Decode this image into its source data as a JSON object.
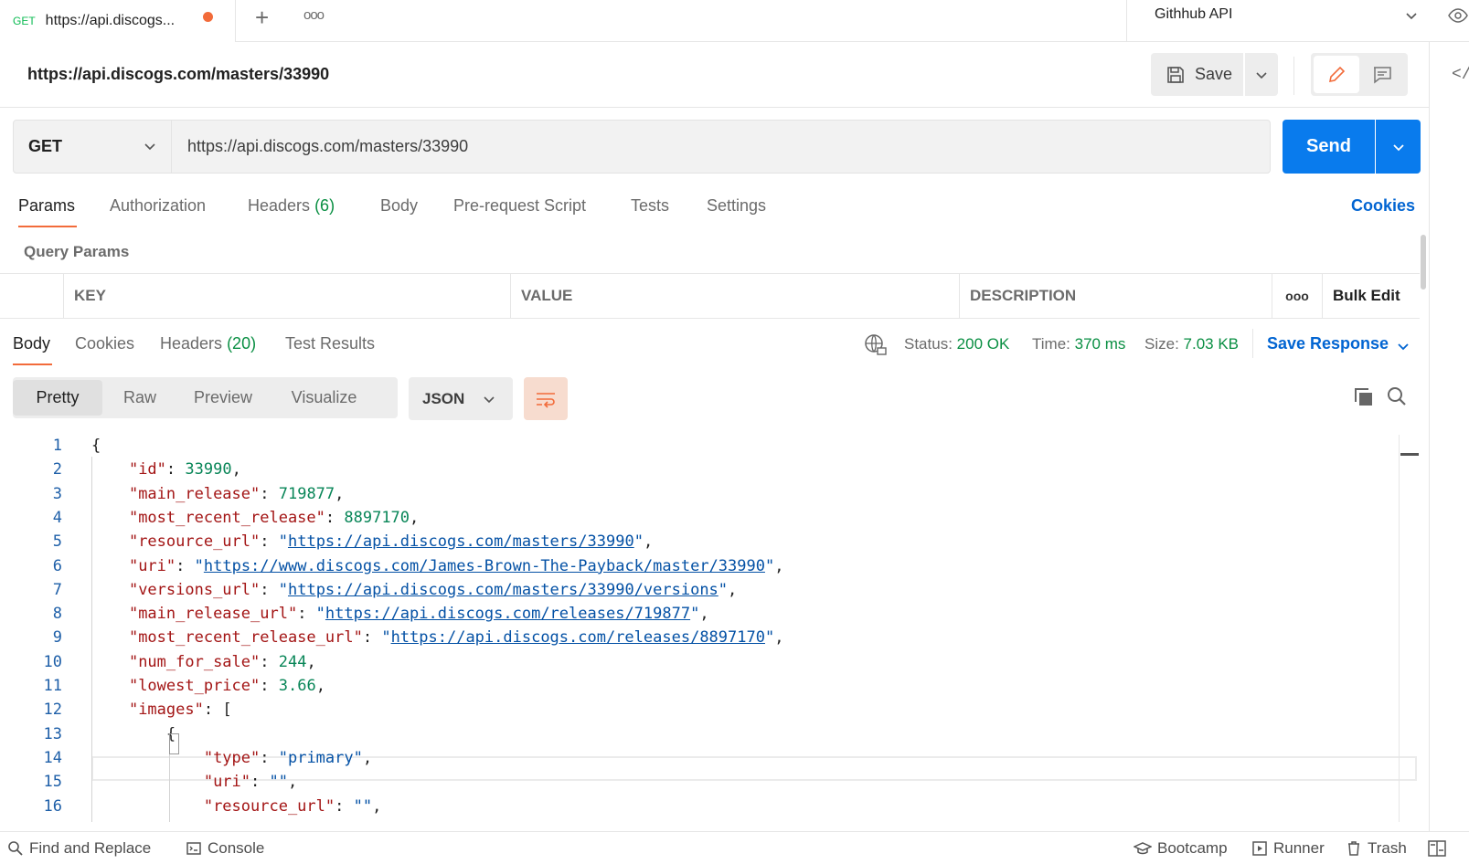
{
  "tabs": {
    "active": {
      "method": "GET",
      "title": "https://api.discogs..."
    },
    "environment": "Githhub API"
  },
  "request": {
    "title": "https://api.discogs.com/masters/33990",
    "save_label": "Save",
    "method": "GET",
    "url": "https://api.discogs.com/masters/33990",
    "send_label": "Send"
  },
  "request_tabs": {
    "params": "Params",
    "authorization": "Authorization",
    "headers": "Headers",
    "headers_count": "(6)",
    "body": "Body",
    "prerequest": "Pre-request Script",
    "tests": "Tests",
    "settings": "Settings",
    "cookies": "Cookies"
  },
  "query_params": {
    "label": "Query Params",
    "columns": {
      "key": "KEY",
      "value": "VALUE",
      "description": "DESCRIPTION",
      "more": "ooo",
      "bulk_edit": "Bulk Edit"
    }
  },
  "response_tabs": {
    "body": "Body",
    "cookies": "Cookies",
    "headers": "Headers",
    "headers_count": "(20)",
    "test_results": "Test Results"
  },
  "response_status": {
    "status_label": "Status:",
    "status_value": "200 OK",
    "time_label": "Time:",
    "time_value": "370 ms",
    "size_label": "Size:",
    "size_value": "7.03 KB",
    "save_response": "Save Response"
  },
  "view_modes": {
    "pretty": "Pretty",
    "raw": "Raw",
    "preview": "Preview",
    "visualize": "Visualize",
    "format": "JSON"
  },
  "code_lines": [
    {
      "n": "1",
      "parts": [
        [
          "p",
          "{"
        ]
      ]
    },
    {
      "n": "2",
      "parts": [
        [
          "p",
          "    "
        ],
        [
          "k",
          "\"id\""
        ],
        [
          "p",
          ": "
        ],
        [
          "n",
          "33990"
        ],
        [
          "p",
          ","
        ]
      ]
    },
    {
      "n": "3",
      "parts": [
        [
          "p",
          "    "
        ],
        [
          "k",
          "\"main_release\""
        ],
        [
          "p",
          ": "
        ],
        [
          "n",
          "719877"
        ],
        [
          "p",
          ","
        ]
      ]
    },
    {
      "n": "4",
      "parts": [
        [
          "p",
          "    "
        ],
        [
          "k",
          "\"most_recent_release\""
        ],
        [
          "p",
          ": "
        ],
        [
          "n",
          "8897170"
        ],
        [
          "p",
          ","
        ]
      ]
    },
    {
      "n": "5",
      "parts": [
        [
          "p",
          "    "
        ],
        [
          "k",
          "\"resource_url\""
        ],
        [
          "p",
          ": "
        ],
        [
          "s",
          "\""
        ],
        [
          "u",
          "https://api.discogs.com/masters/33990"
        ],
        [
          "s",
          "\""
        ],
        [
          "p",
          ","
        ]
      ]
    },
    {
      "n": "6",
      "parts": [
        [
          "p",
          "    "
        ],
        [
          "k",
          "\"uri\""
        ],
        [
          "p",
          ": "
        ],
        [
          "s",
          "\""
        ],
        [
          "u",
          "https://www.discogs.com/James-Brown-The-Payback/master/33990"
        ],
        [
          "s",
          "\""
        ],
        [
          "p",
          ","
        ]
      ]
    },
    {
      "n": "7",
      "parts": [
        [
          "p",
          "    "
        ],
        [
          "k",
          "\"versions_url\""
        ],
        [
          "p",
          ": "
        ],
        [
          "s",
          "\""
        ],
        [
          "u",
          "https://api.discogs.com/masters/33990/versions"
        ],
        [
          "s",
          "\""
        ],
        [
          "p",
          ","
        ]
      ]
    },
    {
      "n": "8",
      "parts": [
        [
          "p",
          "    "
        ],
        [
          "k",
          "\"main_release_url\""
        ],
        [
          "p",
          ": "
        ],
        [
          "s",
          "\""
        ],
        [
          "u",
          "https://api.discogs.com/releases/719877"
        ],
        [
          "s",
          "\""
        ],
        [
          "p",
          ","
        ]
      ]
    },
    {
      "n": "9",
      "parts": [
        [
          "p",
          "    "
        ],
        [
          "k",
          "\"most_recent_release_url\""
        ],
        [
          "p",
          ": "
        ],
        [
          "s",
          "\""
        ],
        [
          "u",
          "https://api.discogs.com/releases/8897170"
        ],
        [
          "s",
          "\""
        ],
        [
          "p",
          ","
        ]
      ]
    },
    {
      "n": "10",
      "parts": [
        [
          "p",
          "    "
        ],
        [
          "k",
          "\"num_for_sale\""
        ],
        [
          "p",
          ": "
        ],
        [
          "n",
          "244"
        ],
        [
          "p",
          ","
        ]
      ]
    },
    {
      "n": "11",
      "parts": [
        [
          "p",
          "    "
        ],
        [
          "k",
          "\"lowest_price\""
        ],
        [
          "p",
          ": "
        ],
        [
          "n",
          "3.66"
        ],
        [
          "p",
          ","
        ]
      ]
    },
    {
      "n": "12",
      "parts": [
        [
          "p",
          "    "
        ],
        [
          "k",
          "\"images\""
        ],
        [
          "p",
          ": ["
        ]
      ]
    },
    {
      "n": "13",
      "parts": [
        [
          "p",
          "        {"
        ]
      ]
    },
    {
      "n": "14",
      "parts": [
        [
          "p",
          "            "
        ],
        [
          "k",
          "\"type\""
        ],
        [
          "p",
          ": "
        ],
        [
          "s",
          "\"primary\""
        ],
        [
          "p",
          ","
        ]
      ]
    },
    {
      "n": "15",
      "parts": [
        [
          "p",
          "            "
        ],
        [
          "k",
          "\"uri\""
        ],
        [
          "p",
          ": "
        ],
        [
          "s",
          "\"\""
        ],
        [
          "p",
          ","
        ]
      ]
    },
    {
      "n": "16",
      "parts": [
        [
          "p",
          "            "
        ],
        [
          "k",
          "\"resource_url\""
        ],
        [
          "p",
          ": "
        ],
        [
          "s",
          "\"\""
        ],
        [
          "p",
          ","
        ]
      ]
    }
  ],
  "status_bar": {
    "find_replace": "Find and Replace",
    "console": "Console",
    "bootcamp": "Bootcamp",
    "runner": "Runner",
    "trash": "Trash"
  },
  "colors": {
    "send": "#097bed",
    "accent": "#f26b3a",
    "ok": "#0a8f43",
    "link": "#0265d2"
  }
}
